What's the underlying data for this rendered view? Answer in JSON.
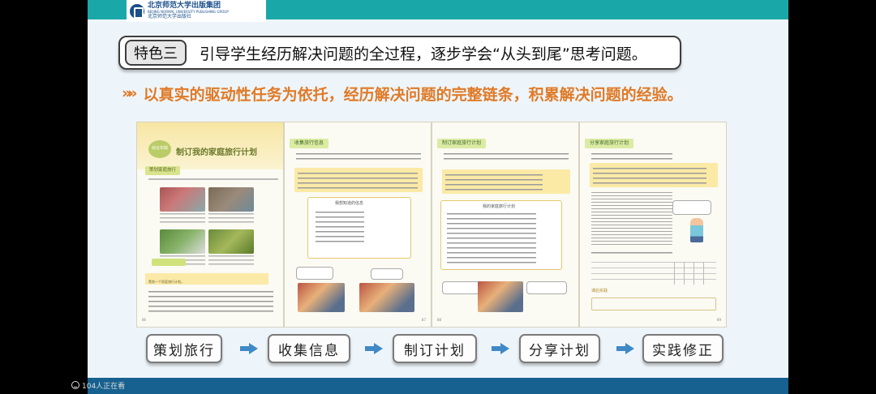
{
  "logo": {
    "cn": "北京师范大学出版集团",
    "en": "BEIJING NORMAL UNIVERSITY PUBLISHING GROUP",
    "sub": "北京师范大学出版社"
  },
  "feature": {
    "tag": "特色三",
    "text": "引导学生经历解决问题的全过程，逐步学会“从头到尾”思考问题。"
  },
  "subhead": {
    "chevrons": "»»",
    "text": "以真实的驱动性任务为依托，经历解决问题的完整链条，积累解决问题的经验。"
  },
  "textbook_pages": [
    {
      "header": "策划家庭旅行",
      "badge": "综合实践",
      "title": "制订我的家庭旅行计划",
      "task": "策划一个家庭旅行计划。",
      "num": "86"
    },
    {
      "header": "收集旅行信息",
      "card_title": "我想知道的信息",
      "num": "87"
    },
    {
      "header": "制订家庭旅行计划",
      "card_title": "我的家庭旅行计划",
      "num": "88"
    },
    {
      "header": "分享家庭旅行计划",
      "section": "课后实践",
      "num": "89"
    }
  ],
  "steps": [
    {
      "label": "策划旅行"
    },
    {
      "label": "收集信息"
    },
    {
      "label": "制订计划"
    },
    {
      "label": "分享计划"
    },
    {
      "label": "实践修正"
    }
  ],
  "viewers": {
    "text": "104人正在看"
  },
  "colors": {
    "accent_orange": "#e07a27",
    "teal": "#1aa7a8",
    "arrow_blue": "#3f89c6",
    "navy": "#16618f"
  }
}
